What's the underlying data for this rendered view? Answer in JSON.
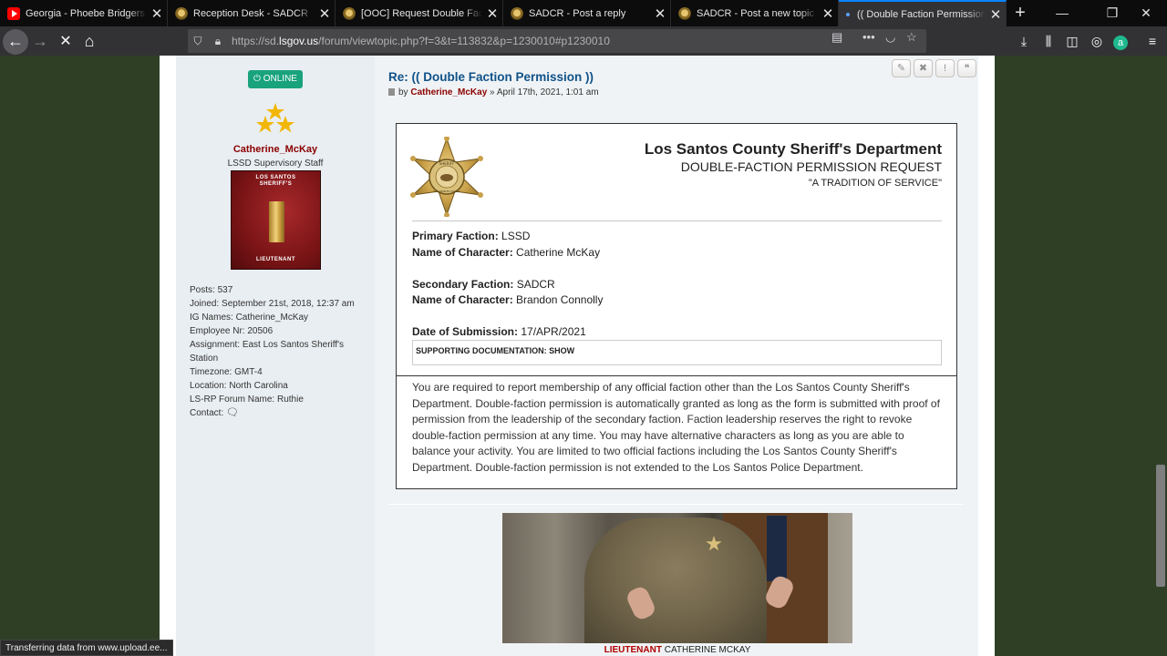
{
  "tabs": [
    {
      "title": "Georgia - Phoebe Bridgers - Y",
      "icon": "youtube-icon",
      "active": false
    },
    {
      "title": "Reception Desk - SADCR",
      "icon": "sadcr-badge-icon",
      "active": false
    },
    {
      "title": "[OOC] Request Double Faction",
      "icon": "sadcr-badge-icon",
      "active": false
    },
    {
      "title": "SADCR - Post a reply",
      "icon": "sadcr-badge-icon",
      "active": false
    },
    {
      "title": "SADCR - Post a new topic",
      "icon": "sadcr-badge-icon",
      "active": false
    },
    {
      "title": "(( Double Faction Permission ))",
      "icon": "loading-dot-icon",
      "active": true
    }
  ],
  "navbar": {
    "url_prefix": "https://sd.",
    "url_domain": "lsgov.us",
    "url_path": "/forum/viewtopic.php?f=3&t=113832&p=1230010#p1230010"
  },
  "profile": {
    "status": "ONLINE",
    "username": "Catherine_McKay",
    "rank": "LSSD Supervisory Staff",
    "patch_top_line1": "LOS SANTOS",
    "patch_top_line2": "SHERIFF'S",
    "patch_bottom": "LIEUTENANT",
    "stats": [
      {
        "label": "Posts:",
        "value": "537"
      },
      {
        "label": "Joined:",
        "value": "September 21st, 2018, 12:37 am"
      },
      {
        "label": "IG Names:",
        "value": "Catherine_McKay"
      },
      {
        "label": "Employee Nr:",
        "value": "20506"
      },
      {
        "label": "Assignment:",
        "value": "East Los Santos Sheriff's Station"
      },
      {
        "label": "Timezone:",
        "value": "GMT-4"
      },
      {
        "label": "Location:",
        "value": "North Carolina"
      },
      {
        "label": "LS-RP Forum Name:",
        "value": "Ruthie"
      },
      {
        "label": "Contact:",
        "value": ""
      }
    ]
  },
  "post": {
    "title": "Re: (( Double Faction Permission ))",
    "by": "by",
    "author": "Catherine_McKay",
    "separator": "»",
    "date": "April 17th, 2021, 1:01 am"
  },
  "form": {
    "department": "Los Santos County Sheriff's Department",
    "subtitle": "DOUBLE-FACTION PERMISSION REQUEST",
    "motto": "\"A TRADITION OF SERVICE\"",
    "badge_text_top": "SHERIFF",
    "badge_text_bottom": "LOS ANGELES COUNTY",
    "primary_faction_label": "Primary Faction:",
    "primary_faction": "LSSD",
    "name1_label": "Name of Character:",
    "name1": "Catherine McKay",
    "secondary_faction_label": "Secondary Faction:",
    "secondary_faction": "SADCR",
    "name2_label": "Name of Character:",
    "name2": "Brandon Connolly",
    "date_label": "Date of Submission:",
    "date": "17/APR/2021",
    "spoiler": "SUPPORTING DOCUMENTATION: SHOW",
    "body": "You are required to report membership of any official faction other than the Los Santos County Sheriff's Department. Double-faction permission is automatically granted as long as the form is submitted with proof of permission from the leadership of the secondary faction. Faction leadership reserves the right to revoke double-faction permission at any time. You may have alternative characters as long as you are able to balance your activity. You are limited to two official factions including the Los Santos County Sheriff's Department. Double-faction permission is not extended to the Los Santos Police Department."
  },
  "media": {
    "caption_rank": "LIEUTENANT",
    "caption_name": "CATHERINE MCKAY"
  },
  "statusbar": "Transferring data from www.upload.ee...",
  "colors": {
    "background": "#2e3f26",
    "link": "#105289",
    "author": "#8b0000",
    "online": "#19a37c"
  }
}
